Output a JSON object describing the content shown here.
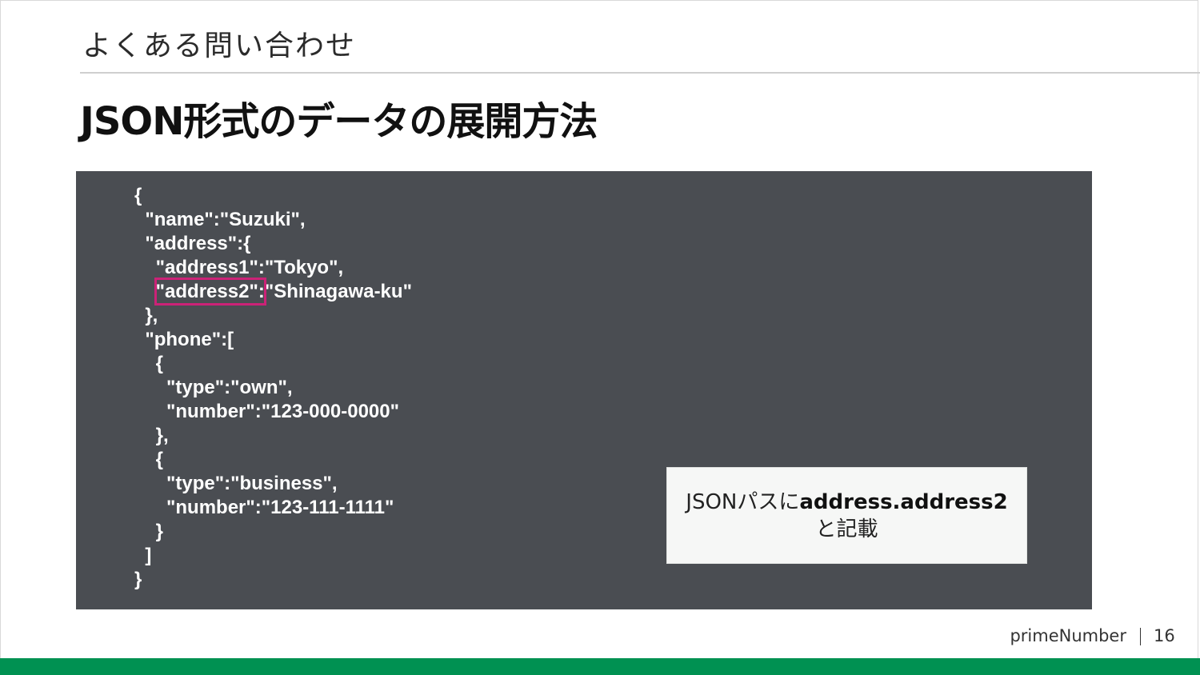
{
  "header": {
    "section": "よくある問い合わせ",
    "title": "JSON形式のデータの展開方法"
  },
  "code": {
    "lines": [
      "{",
      "  \"name\":\"Suzuki\",",
      "  \"address\":{",
      "    \"address1\":\"Tokyo\",",
      "    \"address2\":\"Shinagawa-ku\"",
      "  },",
      "  \"phone\":[",
      "    {",
      "      \"type\":\"own\",",
      "      \"number\":\"123-000-0000\"",
      "    },",
      "    {",
      "      \"type\":\"business\",",
      "      \"number\":\"123-111-1111\"",
      "    }",
      "  ]",
      "}"
    ],
    "highlight_color": "#cc2277",
    "panel_color": "#4a4d52"
  },
  "note": {
    "prefix": "JSONパスに",
    "emphasis": "address.address2",
    "suffix": "と記載"
  },
  "footer": {
    "brand": "primeNumber",
    "page": "16",
    "accent_color": "#009152"
  }
}
